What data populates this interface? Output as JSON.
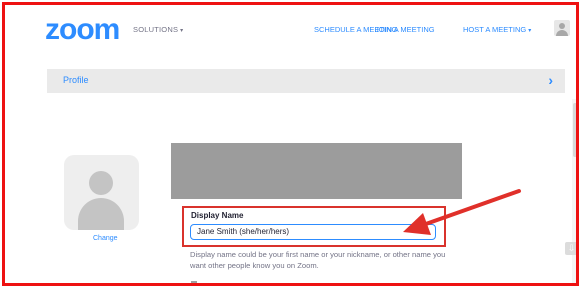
{
  "header": {
    "logo": "zoom",
    "nav_solutions": "SOLUTIONS",
    "nav_schedule": "SCHEDULE A MEETING",
    "nav_join": "JOIN A MEETING",
    "nav_host": "HOST A MEETING",
    "caret_icon": "caret-down-icon",
    "avatar_icon": "user-avatar-icon"
  },
  "profile_bar": {
    "label": "Profile",
    "chevron": "›"
  },
  "profile": {
    "change_label": "Change",
    "display_name_label": "Display Name",
    "display_name_value": "Jane Smith (she/her/hers)",
    "helper_text": "Display name could be your first name or your nickname, or other name you want other people know you on Zoom."
  },
  "annotation": {
    "highlight_color": "#d9332c",
    "arrow_color": "#e0302a",
    "frame_color": "#ee1111"
  },
  "colors": {
    "accent": "#2d8cff",
    "text": "#232333",
    "muted": "#747487"
  }
}
